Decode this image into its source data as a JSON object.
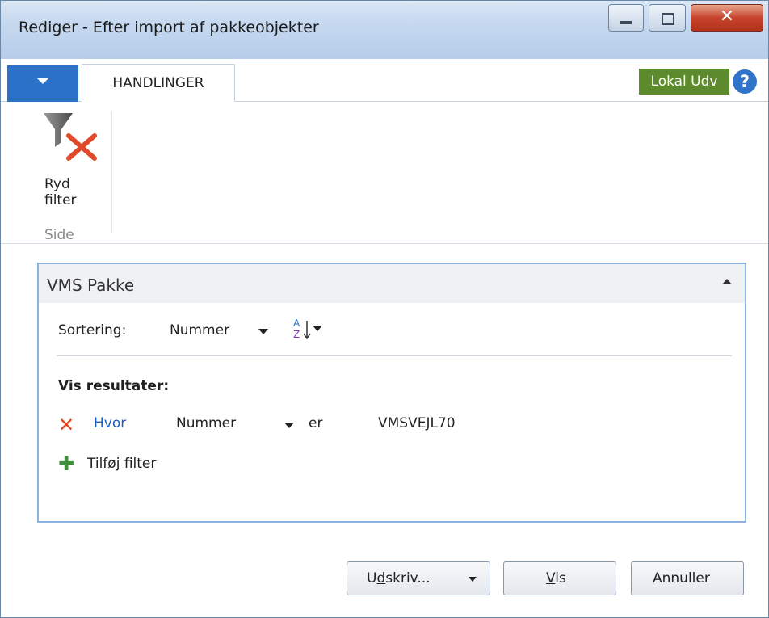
{
  "window": {
    "title": "Rediger - Efter import af pakkeobjekter"
  },
  "ribbon": {
    "tab_label": "HANDLINGER",
    "environment_badge": "Lokal Udv",
    "help_glyph": "?",
    "actions": [
      {
        "label_line1": "Ryd",
        "label_line2": "filter",
        "icon": "clear-filter-icon"
      }
    ],
    "group_label": "Side"
  },
  "panel": {
    "title": "VMS Pakke",
    "sort_label": "Sortering:",
    "sort_value": "Nummer",
    "sort_icon": "sort-az-icon",
    "results_heading": "Vis resultater:",
    "filter": {
      "prefix": "Hvor",
      "field": "Nummer",
      "operator": "er",
      "value": "VMSVEJL70"
    },
    "add_filter_label": "Tilføj filter"
  },
  "buttons": {
    "print_pre": "U",
    "print_accel": "d",
    "print_post": "skriv...",
    "show_accel": "V",
    "show_post": "is",
    "cancel_label": "Annuller"
  },
  "colors": {
    "accent_blue": "#2a71c7",
    "badge_green": "#5d8a2c",
    "panel_border": "#89b4e3",
    "remove_red": "#e0421e",
    "add_green": "#3f8f3b"
  }
}
